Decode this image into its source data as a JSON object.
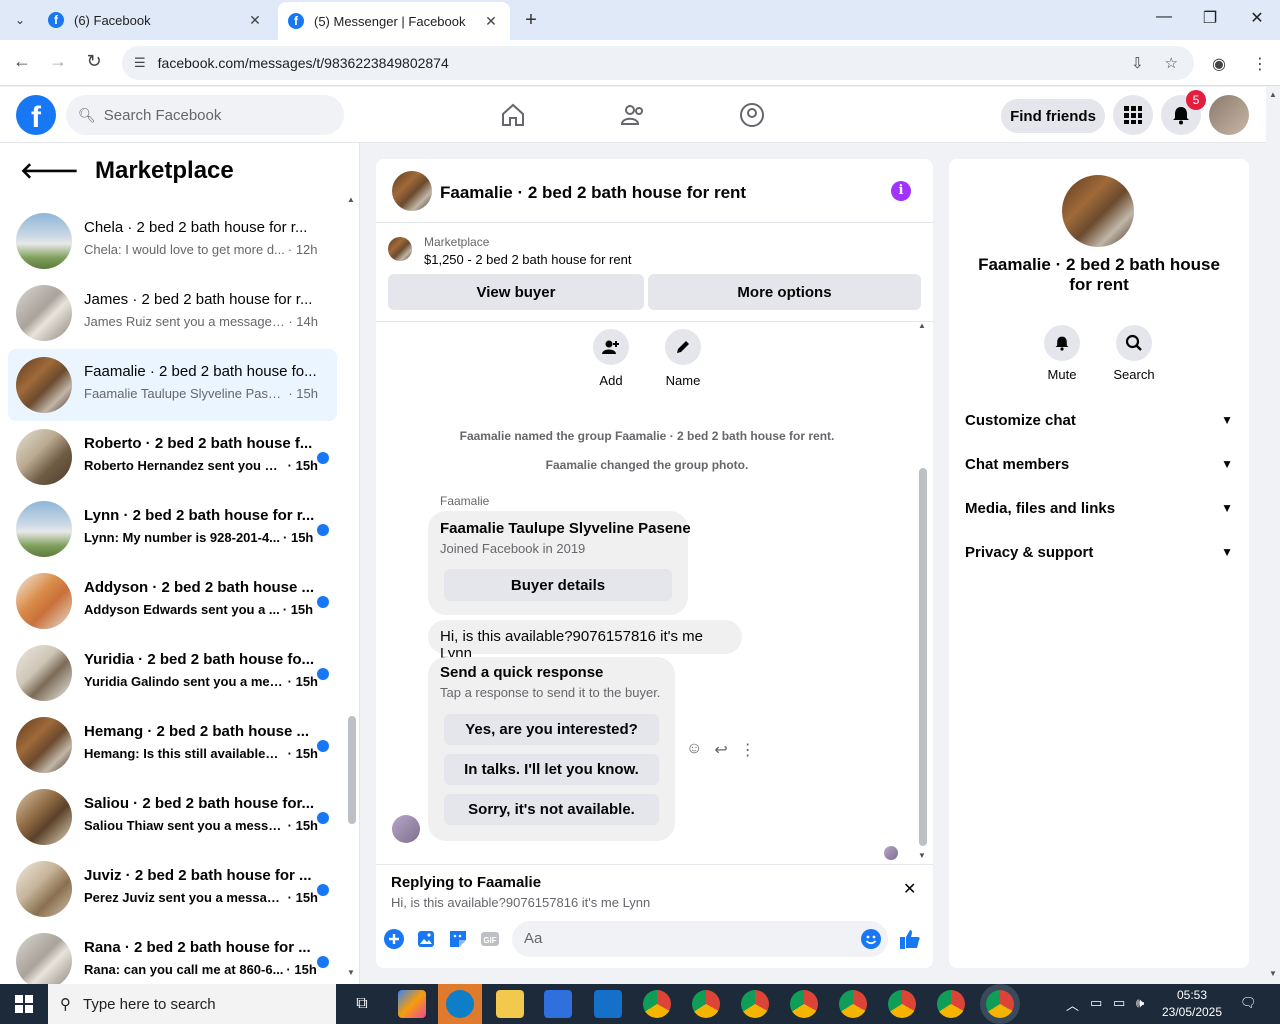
{
  "browser": {
    "tabs": [
      {
        "title": "(6) Facebook",
        "active": false
      },
      {
        "title": "(5) Messenger | Facebook",
        "active": true
      }
    ],
    "url": "facebook.com/messages/t/9836223849802874"
  },
  "fb_header": {
    "search_placeholder": "Search Facebook",
    "find_friends_label": "Find friends",
    "notification_count": "5"
  },
  "left": {
    "title": "Marketplace",
    "conversations": [
      {
        "title": "Chela · 2 bed 2 bath house for r...",
        "snippet": "Chela: I would love to get more d...",
        "time": "· 12h",
        "unread": false,
        "selected": false
      },
      {
        "title": "James · 2 bed 2 bath house for r...",
        "snippet": "James Ruiz sent you a message ab...",
        "time": "· 14h",
        "unread": false,
        "selected": false
      },
      {
        "title": "Faamalie · 2 bed 2 bath house fo...",
        "snippet": "Faamalie Taulupe Slyveline Pasene...",
        "time": "· 15h",
        "unread": false,
        "selected": true
      },
      {
        "title": "Roberto · 2 bed 2 bath house f...",
        "snippet": "Roberto Hernandez sent you a ...",
        "time": "· 15h",
        "unread": true,
        "selected": false
      },
      {
        "title": "Lynn · 2 bed 2 bath house for r...",
        "snippet": "Lynn: My number is 928-201-4...",
        "time": "· 15h",
        "unread": true,
        "selected": false
      },
      {
        "title": "Addyson · 2 bed 2 bath house ...",
        "snippet": "Addyson Edwards sent you a ...",
        "time": "· 15h",
        "unread": true,
        "selected": false
      },
      {
        "title": "Yuridia · 2 bed 2 bath house fo...",
        "snippet": "Yuridia Galindo sent you a mes...",
        "time": "· 15h",
        "unread": true,
        "selected": false
      },
      {
        "title": "Hemang · 2 bed 2 bath house ...",
        "snippet": "Hemang: Is this still available? ...",
        "time": "· 15h",
        "unread": true,
        "selected": false
      },
      {
        "title": "Saliou · 2 bed 2 bath house for...",
        "snippet": "Saliou Thiaw sent you a messa...",
        "time": "· 15h",
        "unread": true,
        "selected": false
      },
      {
        "title": "Juviz · 2 bed 2 bath house for ...",
        "snippet": "Perez Juviz sent you a message...",
        "time": "· 15h",
        "unread": true,
        "selected": false
      },
      {
        "title": "Rana · 2 bed 2 bath house for ...",
        "snippet": "Rana: can you call me at 860-6...",
        "time": "· 15h",
        "unread": true,
        "selected": false
      }
    ]
  },
  "chat": {
    "title": "Faamalie · 2 bed 2 bath house for rent",
    "marketplace_label": "Marketplace",
    "listing": "$1,250 - 2 bed 2 bath house for rent",
    "view_buyer": "View buyer",
    "more_options": "More options",
    "add_label": "Add",
    "name_label": "Name",
    "system_messages": [
      "Faamalie named the group Faamalie · 2 bed 2 bath house for rent.",
      "Faamalie changed the group photo."
    ],
    "sender": "Faamalie",
    "buyer_name": "Faamalie Taulupe Slyveline Pasene",
    "buyer_joined": "Joined Facebook in 2019",
    "buyer_details": "Buyer details",
    "message": "Hi, is this available?9076157816 it's me Lynn",
    "quick_title": "Send a quick response",
    "quick_sub": "Tap a response to send it to the buyer.",
    "quick_responses": [
      "Yes, are you interested?",
      "In talks. I'll let you know.",
      "Sorry, it's not available."
    ],
    "replying_to": "Replying to Faamalie",
    "replying_snippet": "Hi, is this available?9076157816 it's me Lynn",
    "composer_placeholder": "Aa"
  },
  "right": {
    "title": "Faamalie · 2 bed 2 bath house for rent",
    "mute": "Mute",
    "search": "Search",
    "sections": [
      "Customize chat",
      "Chat members",
      "Media, files and links",
      "Privacy & support"
    ]
  },
  "taskbar": {
    "search_placeholder": "Type here to search",
    "time": "05:53",
    "date": "23/05/2025"
  },
  "colors": {
    "fb_blue": "#1877f2",
    "info_purple": "#a033ff",
    "badge_red": "#e41e3f"
  }
}
